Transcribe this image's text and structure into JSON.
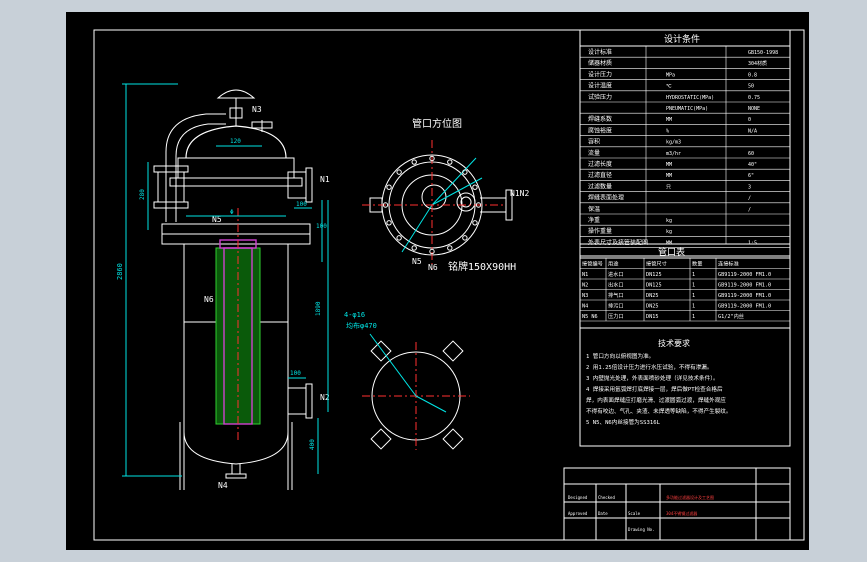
{
  "view_top_title": "管口方位图",
  "weight_label": "铭牌150X90HH",
  "nozzle_labels": {
    "n1": "N1",
    "n2": "N2",
    "n3": "N3",
    "n4": "N4",
    "n5": "N5",
    "n6": "N6",
    "n1n2": "N1N2",
    "n5b": "N5",
    "n6b": "N6"
  },
  "dims": {
    "d1": "2860",
    "d2": "120",
    "d3": "280",
    "d4": "100",
    "d5": "100",
    "d6": "1890",
    "d7": "100",
    "d8": "400",
    "d9": "300",
    "d10": "Φ",
    "d11": "4-φ16",
    "d12": "均布φ470"
  },
  "design_title": "设计条件",
  "design_rows": [
    {
      "k": "设计标准",
      "v": "GB150-1998"
    },
    {
      "k": "储器材质",
      "v": "304材质"
    },
    {
      "k": "设计压力",
      "u": "MPa",
      "v": "0.8"
    },
    {
      "k": "设计温度",
      "u": "℃",
      "v": "50"
    },
    {
      "k": "试验压力",
      "u": "HYDROSTATIC(MPa)",
      "v": "0.75"
    },
    {
      "k": "",
      "u": "PNEUMATIC(MPa)",
      "v": "NONE"
    },
    {
      "k": "焊缝系数",
      "u": "MM",
      "v": "0"
    },
    {
      "k": "腐蚀裕度",
      "u": "%",
      "v": "N/A"
    },
    {
      "k": "容积",
      "u": "kg/m3",
      "v": ""
    },
    {
      "k": "流量",
      "u": "m3/hr",
      "v": "60"
    },
    {
      "k": "过滤长度",
      "u": "MM",
      "v": "40\""
    },
    {
      "k": "过滤直径",
      "u": "MM",
      "v": "6\""
    },
    {
      "k": "过滤数量",
      "u": "只",
      "v": "3"
    },
    {
      "k": "焊缝表面处理",
      "u": "",
      "v": "/"
    },
    {
      "k": "保温",
      "u": "",
      "v": "/"
    },
    {
      "k": "净重",
      "u": "kg",
      "v": ""
    },
    {
      "k": "操作重量",
      "u": "kg",
      "v": ""
    },
    {
      "k": "外表尺寸及接管装配图",
      "u": "MM",
      "v": "1:5"
    }
  ],
  "nozzle_title": "管口表",
  "nozzle_headers": [
    "接管编号",
    "用途",
    "接管尺寸",
    "数量",
    "连接标准"
  ],
  "nozzle_rows": [
    [
      "N1",
      "进水口",
      "DN125",
      "1",
      "GB9119-2000 FM1.0"
    ],
    [
      "N2",
      "出水口",
      "DN125",
      "1",
      "GB9119-2000 FM1.0"
    ],
    [
      "N3",
      "排气口",
      "DN25",
      "1",
      "GB9119-2000 FM1.0"
    ],
    [
      "N4",
      "排污口",
      "DN25",
      "1",
      "GB9119-2000 FM1.0"
    ],
    [
      "N5 N6",
      "压力口",
      "DN15",
      "1",
      "G1/2\"内丝"
    ]
  ],
  "tech_title": "技术要求",
  "tech_lines": [
    "1 管口方向以俯视图为准。",
    "2 用1.25倍设计压力进行水压试验，不得有渗漏。",
    "3 内壁抛光处理，外表面喷砂处理（详见技术条件）。",
    "4 焊接采用氩弧焊打底焊接一层，焊后做PT检查合格后",
    "  焊，内表面焊缝应打磨光滑、过渡圆弧过渡，焊缝外观应",
    "  不得有咬边、气孔、夹渣、未焊透等缺陷，不得产生裂纹。",
    "5 N5、N6内丝接管为SS316L"
  ],
  "title_block": {
    "designed": "Designed",
    "checked": "Checked",
    "approved": "Approved",
    "date": "Date",
    "scale": "Scale",
    "drawing_no": "Drawing No.",
    "project": "多功能过滤器设计及工艺图",
    "drawing_title": "304不锈钢过滤器"
  }
}
